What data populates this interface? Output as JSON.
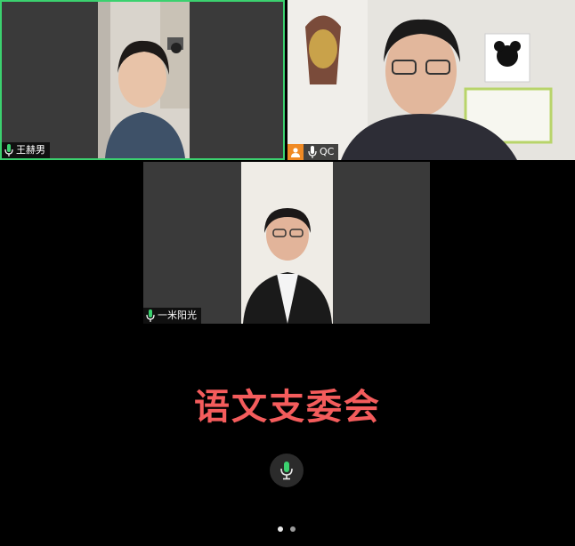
{
  "participants": [
    {
      "name": "王赫男",
      "host": false,
      "mic_on": true,
      "active_speaker": true
    },
    {
      "name": "QC",
      "host": true,
      "mic_on": true,
      "active_speaker": false
    },
    {
      "name": "一米阳光",
      "host": false,
      "mic_on": true,
      "active_speaker": false
    }
  ],
  "meeting_banner": "语文支委会",
  "toolbar": {
    "mic_state": "unmuted"
  },
  "pager": {
    "current_page": 1,
    "total_pages": 2
  },
  "colors": {
    "active_border": "#3bd16f",
    "mic_icon": "#3bd16f",
    "banner_text": "#f45c5c",
    "host_badge": "#f08a24"
  }
}
